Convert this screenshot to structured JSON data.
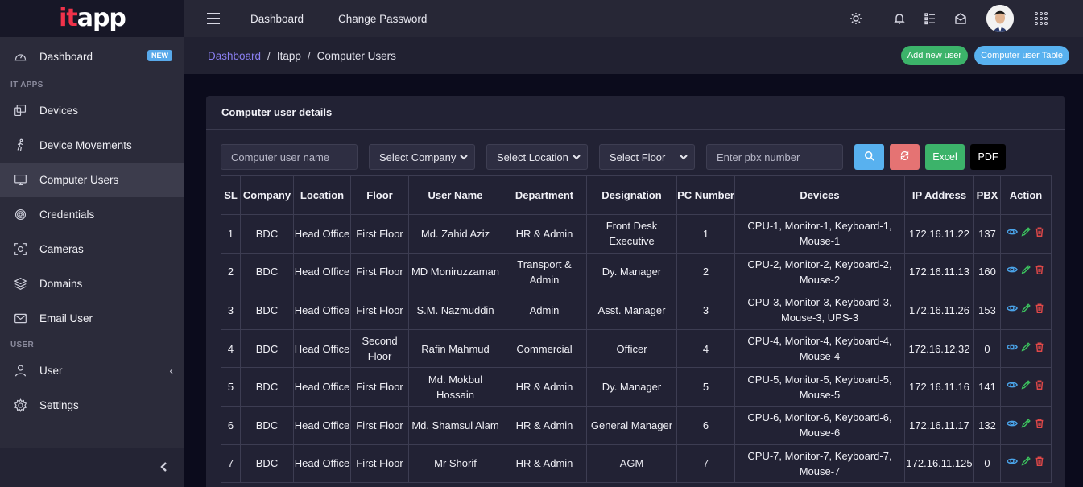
{
  "brand": {
    "logo_prefix": "it",
    "logo_suffix": "app"
  },
  "sidebar": {
    "items": [
      {
        "label": "Dashboard",
        "icon": "speedometer-icon",
        "badge": "NEW"
      },
      {
        "section": "IT APPS"
      },
      {
        "label": "Devices",
        "icon": "devices-icon"
      },
      {
        "label": "Device Movements",
        "icon": "walking-icon"
      },
      {
        "label": "Computer Users",
        "icon": "monitor-icon",
        "active": true
      },
      {
        "label": "Credentials",
        "icon": "fingerprint-icon"
      },
      {
        "label": "Cameras",
        "icon": "camera-icon"
      },
      {
        "label": "Domains",
        "icon": "layers-icon"
      },
      {
        "label": "Email User",
        "icon": "envelope-icon"
      },
      {
        "section": "USER"
      },
      {
        "label": "User",
        "icon": "user-icon",
        "has_children": true
      },
      {
        "label": "Settings",
        "icon": "gear-icon"
      }
    ],
    "section_it_apps": "IT APPS",
    "section_user": "USER",
    "dashboard": "Dashboard",
    "dashboard_badge": "NEW",
    "devices": "Devices",
    "device_movements": "Device Movements",
    "computer_users": "Computer Users",
    "credentials": "Credentials",
    "cameras": "Cameras",
    "domains": "Domains",
    "email_user": "Email User",
    "user": "User",
    "settings": "Settings"
  },
  "topbar": {
    "links": [
      "Dashboard",
      "Change Password"
    ],
    "dashboard": "Dashboard",
    "change_password": "Change Password"
  },
  "breadcrumb": {
    "items": [
      "Dashboard",
      "Itapp",
      "Computer Users"
    ],
    "home": "Dashboard",
    "app": "Itapp",
    "current": "Computer Users",
    "separator": "/"
  },
  "actions": {
    "add_new_user": "Add new user",
    "computer_user_table": "Computer user Table"
  },
  "card": {
    "title": "Computer user details"
  },
  "filters": {
    "name_placeholder": "Computer user name",
    "company": "Select Company",
    "location": "Select Location",
    "floor": "Select Floor",
    "pbx_placeholder": "Enter pbx number",
    "excel": "Excel",
    "pdf": "PDF"
  },
  "table": {
    "columns": [
      "SL",
      "Company",
      "Location",
      "Floor",
      "User Name",
      "Department",
      "Designation",
      "PC Number",
      "Devices",
      "IP Address",
      "PBX",
      "Action"
    ],
    "rows": [
      [
        "1",
        "BDC",
        "Head Office",
        "First Floor",
        "Md. Zahid Aziz",
        "HR & Admin",
        "Front Desk Executive",
        "1",
        "CPU-1, Monitor-1, Keyboard-1, Mouse-1",
        "172.16.11.22",
        "137"
      ],
      [
        "2",
        "BDC",
        "Head Office",
        "First Floor",
        "MD Moniruzzaman",
        "Transport & Admin",
        "Dy. Manager",
        "2",
        "CPU-2, Monitor-2, Keyboard-2, Mouse-2",
        "172.16.11.13",
        "160"
      ],
      [
        "3",
        "BDC",
        "Head Office",
        "First Floor",
        "S.M. Nazmuddin",
        "Admin",
        "Asst. Manager",
        "3",
        "CPU-3, Monitor-3, Keyboard-3, Mouse-3, UPS-3",
        "172.16.11.26",
        "153"
      ],
      [
        "4",
        "BDC",
        "Head Office",
        "Second Floor",
        "Rafin Mahmud",
        "Commercial",
        "Officer",
        "4",
        "CPU-4, Monitor-4, Keyboard-4, Mouse-4",
        "172.16.12.32",
        "0"
      ],
      [
        "5",
        "BDC",
        "Head Office",
        "First Floor",
        "Md. Mokbul Hossain",
        "HR & Admin",
        "Dy. Manager",
        "5",
        "CPU-5, Monitor-5, Keyboard-5, Mouse-5",
        "172.16.11.16",
        "141"
      ],
      [
        "6",
        "BDC",
        "Head Office",
        "First Floor",
        "Md. Shamsul Alam",
        "HR & Admin",
        "General Manager",
        "6",
        "CPU-6, Monitor-6, Keyboard-6, Mouse-6",
        "172.16.11.17",
        "132"
      ],
      [
        "7",
        "BDC",
        "Head Office",
        "First Floor",
        "Mr Shorif",
        "HR & Admin",
        "AGM",
        "7",
        "CPU-7, Monitor-7, Keyboard-7, Mouse-7",
        "172.16.11.125",
        "0"
      ]
    ]
  },
  "colors": {
    "accent_link": "#8a7ff0",
    "search_button": "#58b1ef",
    "reset_button": "#e57373",
    "excel_button": "#3cb36a",
    "pdf_button": "#000000",
    "view_icon": "#4aa3e8",
    "edit_icon": "#3cc25e",
    "delete_icon": "#e04848"
  }
}
